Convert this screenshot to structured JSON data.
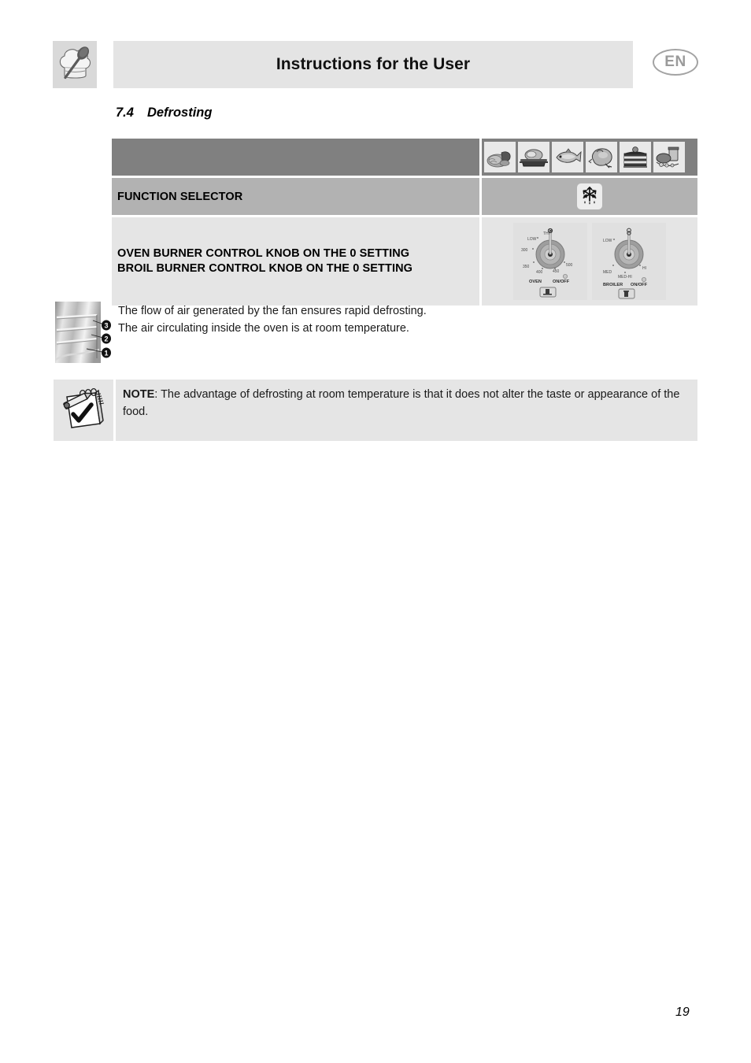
{
  "header": {
    "title": "Instructions for the User",
    "language_badge": "EN",
    "icon": "chef-hat-spoon-icon"
  },
  "section": {
    "number": "7.4",
    "title": "Defrosting"
  },
  "table": {
    "food_icons": [
      {
        "name": "bread-rolls-icon",
        "label": "bread"
      },
      {
        "name": "roast-meat-pan-icon",
        "label": "roast"
      },
      {
        "name": "fish-icon",
        "label": "fish"
      },
      {
        "name": "poultry-chicken-icon",
        "label": "poultry"
      },
      {
        "name": "layer-cake-icon",
        "label": "cake"
      },
      {
        "name": "preserves-canning-icon",
        "label": "preserves"
      }
    ],
    "function_selector": {
      "label": "FUNCTION SELECTOR",
      "icon": "snowflake-defrost-icon"
    },
    "knob_settings": {
      "line1": "OVEN BURNER CONTROL KNOB ON THE 0 SETTING",
      "line2": "BROIL BURNER CONTROL KNOB ON THE 0 SETTING"
    },
    "oven_knob": {
      "name": "oven-burner-knob",
      "labels": {
        "top": "THE",
        "low": "LOW",
        "t300": "300",
        "t350": "350",
        "t400": "400",
        "t450": "450",
        "t500": "500",
        "caption_left": "OVEN",
        "caption_right": "ON/OFF"
      }
    },
    "broil_knob": {
      "name": "broil-burner-knob",
      "labels": {
        "low": "LOW",
        "med": "MED",
        "medhi": "MED-HI",
        "hi": "HI",
        "caption_left": "BROILER",
        "caption_right": "ON/OFF"
      }
    }
  },
  "body": {
    "oven_rack_icon": "oven-cavity-shelf-positions-icon",
    "shelf_numbers": [
      "3",
      "2",
      "1"
    ],
    "line1": "The flow of air generated by the fan ensures rapid defrosting.",
    "line2": "The air circulating inside the oven is at room temperature."
  },
  "note": {
    "icon": "notepad-pen-check-icon",
    "label": "NOTE",
    "text": ": The advantage of defrosting at room temperature is that it does not alter the taste or appearance of the food."
  },
  "footer": {
    "page_number": "19"
  },
  "colors": {
    "row_dark": "#808080",
    "row_medium": "#b2b2b2",
    "row_light": "#e5e5e5",
    "header_bar": "#e4e4e4",
    "badge_gray": "#9a9a9a"
  }
}
